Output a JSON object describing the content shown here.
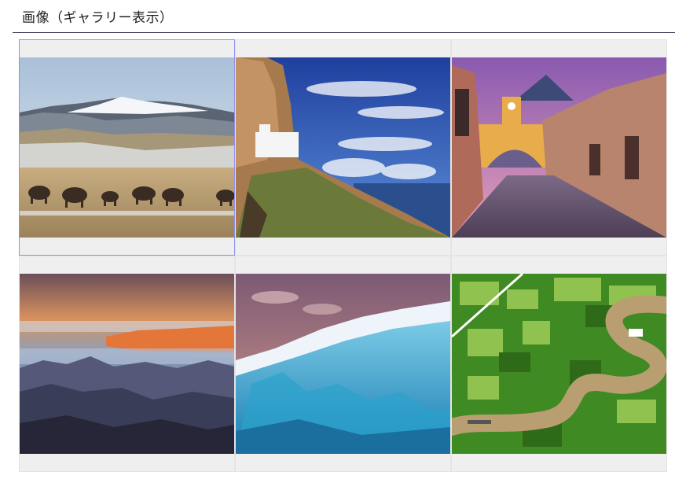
{
  "page": {
    "title": "画像（ギャラリー表示）"
  },
  "gallery": {
    "selected_index": 0,
    "items": [
      {
        "name": "bison-mountains",
        "palette": [
          "#c9d8e8",
          "#e9eef3",
          "#b29a74",
          "#3b2e24"
        ]
      },
      {
        "name": "cliff-monastery",
        "palette": [
          "#2e54b8",
          "#f2f4f8",
          "#b58a5a",
          "#3b4f2a"
        ]
      },
      {
        "name": "colonial-street-arch",
        "palette": [
          "#6a4f8f",
          "#e6a84a",
          "#b07a6a",
          "#6d5060"
        ]
      },
      {
        "name": "canyon-sunrise",
        "palette": [
          "#5b6078",
          "#e67a3a",
          "#3b4560",
          "#2a2a3a"
        ]
      },
      {
        "name": "ice-ridge",
        "palette": [
          "#9a6a78",
          "#e7edf4",
          "#3fb7d6",
          "#1d6f9a"
        ]
      },
      {
        "name": "river-rice-fields",
        "palette": [
          "#4f9a2a",
          "#a9c96a",
          "#b9a07a",
          "#2e5a1e"
        ]
      }
    ]
  }
}
